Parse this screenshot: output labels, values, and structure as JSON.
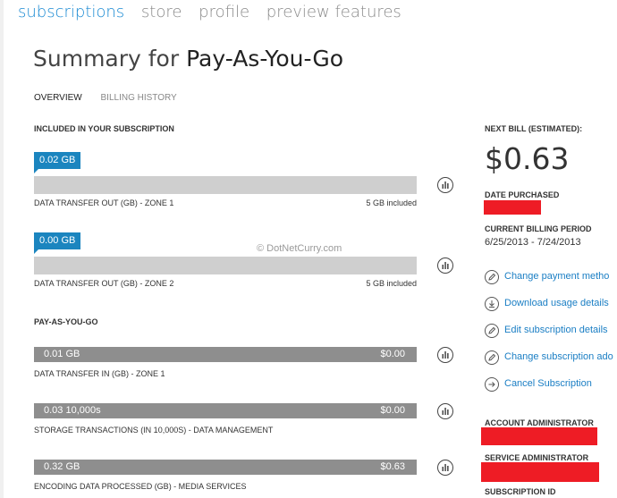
{
  "nav": {
    "items": [
      "subscriptions",
      "store",
      "profile",
      "preview features"
    ]
  },
  "title": {
    "prefix": "Summary for ",
    "name": "Pay-As-You-Go"
  },
  "tabs": [
    "OVERVIEW",
    "BILLING HISTORY"
  ],
  "included": {
    "heading": "INCLUDED IN YOUR SUBSCRIPTION",
    "rows": [
      {
        "usage": "0.02 GB",
        "label": "DATA TRANSFER OUT (GB) - ZONE 1",
        "included": "5 GB included"
      },
      {
        "usage": "0.00 GB",
        "label": "DATA TRANSFER OUT (GB) - ZONE 2",
        "included": "5 GB included"
      }
    ]
  },
  "payg": {
    "heading": "PAY-AS-YOU-GO",
    "rows": [
      {
        "usage": "0.01 GB",
        "cost": "$0.00",
        "label": "DATA TRANSFER IN (GB) - ZONE 1"
      },
      {
        "usage": "0.03 10,000s",
        "cost": "$0.00",
        "label": "STORAGE TRANSACTIONS (IN 10,000S) - DATA MANAGEMENT"
      },
      {
        "usage": "0.32 GB",
        "cost": "$0.63",
        "label": "ENCODING DATA PROCESSED (GB) - MEDIA SERVICES"
      }
    ]
  },
  "bill": {
    "next_bill_heading": "NEXT BILL (ESTIMATED):",
    "amount": "$0.63",
    "date_purchased_heading": "DATE PURCHASED",
    "billing_period_heading": "CURRENT BILLING PERIOD",
    "billing_period": "6/25/2013 - 7/24/2013",
    "account_admin_heading": "ACCOUNT ADMINISTRATOR",
    "service_admin_heading": "SERVICE ADMINISTRATOR",
    "subscription_id_heading": "SUBSCRIPTION ID"
  },
  "actions": [
    {
      "icon": "pencil-icon",
      "label": "Change payment metho"
    },
    {
      "icon": "download-icon",
      "label": "Download usage details"
    },
    {
      "icon": "pencil-icon",
      "label": "Edit subscription details"
    },
    {
      "icon": "pencil-icon",
      "label": "Change subscription ado"
    },
    {
      "icon": "arrow-right-icon",
      "label": "Cancel Subscription"
    }
  ],
  "watermark": "© DotNetCurry.com",
  "colors": {
    "accent": "#1a8ad3",
    "tag": "#1b85bf",
    "bar_included": "#cfcfcf",
    "bar_payg": "#8e8e8e",
    "redaction": "#ee1c25"
  }
}
